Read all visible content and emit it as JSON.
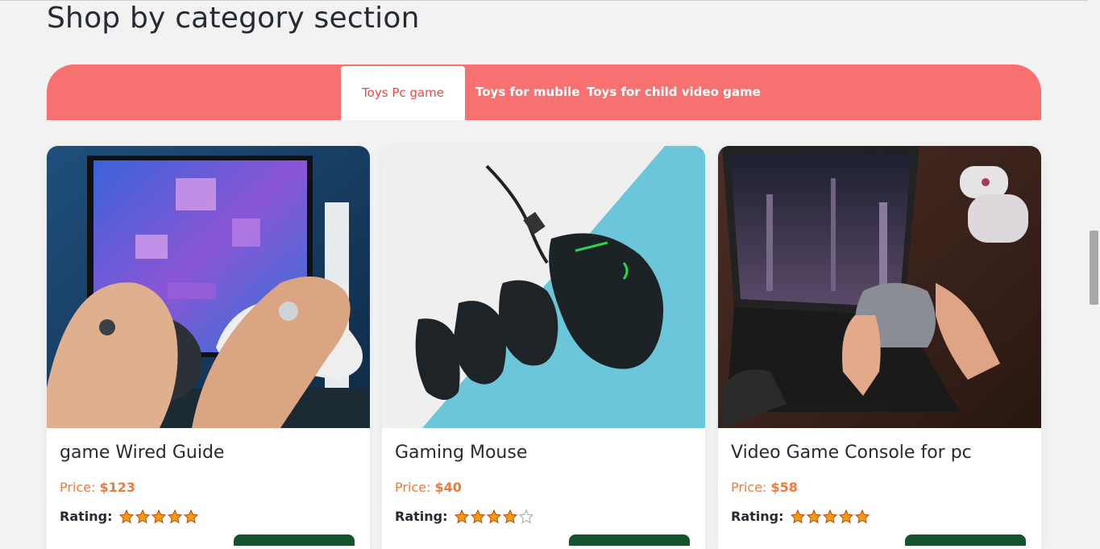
{
  "section": {
    "title": "Shop by category section"
  },
  "tabs": [
    {
      "label": "Toys Pc game",
      "active": true
    },
    {
      "label": "Toys for mubile",
      "active": false
    },
    {
      "label": "Toys for child video game",
      "active": false
    }
  ],
  "rating_label": "Rating:",
  "price_label": "Price:",
  "cards": [
    {
      "title": "game Wired Guide",
      "price": "$123",
      "rating": 5,
      "image": "console-gamepads-photo"
    },
    {
      "title": "Gaming Mouse",
      "price": "$40",
      "rating": 4,
      "image": "gaming-mouse-photo"
    },
    {
      "title": "Video Game Console for pc",
      "price": "$58",
      "rating": 5,
      "image": "laptop-controller-photo"
    }
  ],
  "colors": {
    "tabbar": "#f87171",
    "active_tab_text": "#ef4444",
    "price": "#ef7a3a",
    "star": "#f59e0b"
  }
}
